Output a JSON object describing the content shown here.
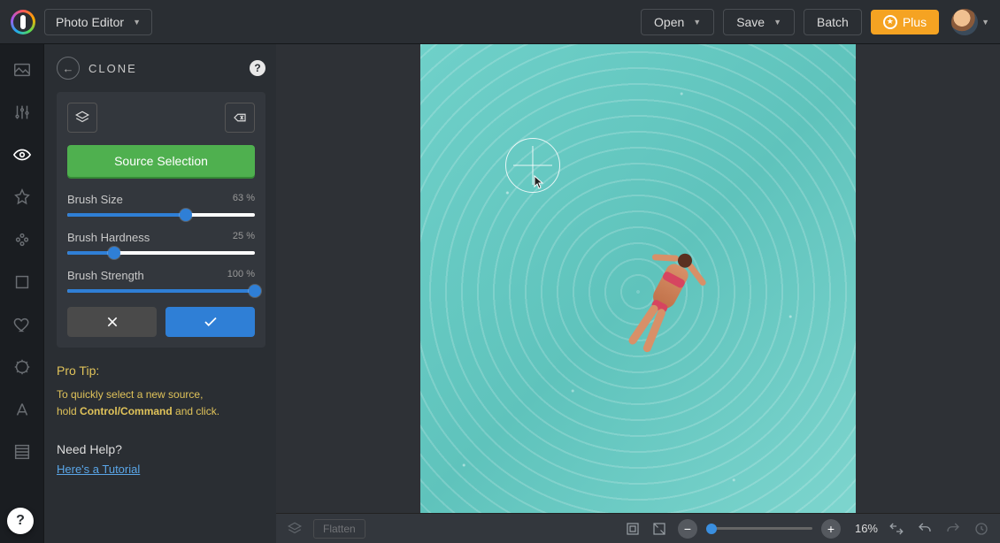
{
  "header": {
    "app_title": "Photo Editor",
    "open_label": "Open",
    "save_label": "Save",
    "batch_label": "Batch",
    "plus_label": "Plus"
  },
  "panel": {
    "title": "CLONE",
    "source_button": "Source Selection",
    "sliders": {
      "brush_size": {
        "label": "Brush Size",
        "value": "63 %",
        "pct": 63
      },
      "brush_hardness": {
        "label": "Brush Hardness",
        "value": "25 %",
        "pct": 25
      },
      "brush_strength": {
        "label": "Brush Strength",
        "value": "100 %",
        "pct": 100
      }
    },
    "tip_title": "Pro Tip:",
    "tip_line1": "To quickly select a new source,",
    "tip_line2a": "hold ",
    "tip_line2b": "Control/Command",
    "tip_line2c": " and click.",
    "help_title": "Need Help?",
    "help_link": "Here's a Tutorial"
  },
  "bottom": {
    "flatten_label": "Flatten",
    "zoom_value": "16%"
  }
}
